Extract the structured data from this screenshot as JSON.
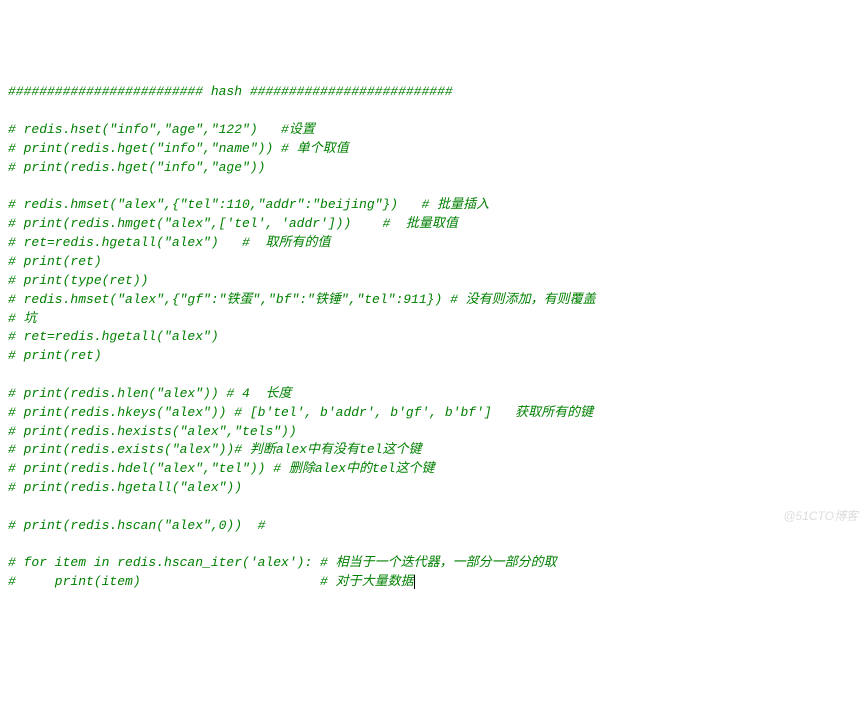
{
  "lines": [
    {
      "t": "comment",
      "text": "######################### hash ##########################"
    },
    {
      "t": "blank",
      "text": ""
    },
    {
      "t": "comment",
      "text": "# redis.hset(\"info\",\"age\",\"122\")   #设置"
    },
    {
      "t": "comment",
      "text": "# print(redis.hget(\"info\",\"name\")) # 单个取值"
    },
    {
      "t": "comment",
      "text": "# print(redis.hget(\"info\",\"age\"))"
    },
    {
      "t": "blank",
      "text": ""
    },
    {
      "t": "comment",
      "text": "# redis.hmset(\"alex\",{\"tel\":110,\"addr\":\"beijing\"})   # 批量插入"
    },
    {
      "t": "comment",
      "text": "# print(redis.hmget(\"alex\",['tel', 'addr']))    #  批量取值"
    },
    {
      "t": "comment",
      "text": "# ret=redis.hgetall(\"alex\")   #  取所有的值"
    },
    {
      "t": "comment",
      "text": "# print(ret)"
    },
    {
      "t": "comment",
      "text": "# print(type(ret))"
    },
    {
      "t": "comment",
      "text": "# redis.hmset(\"alex\",{\"gf\":\"铁蛋\",\"bf\":\"铁锤\",\"tel\":911}) # 没有则添加，有则覆盖"
    },
    {
      "t": "comment",
      "text": "# 坑"
    },
    {
      "t": "comment",
      "text": "# ret=redis.hgetall(\"alex\")"
    },
    {
      "t": "comment",
      "text": "# print(ret)"
    },
    {
      "t": "blank",
      "text": ""
    },
    {
      "t": "comment",
      "text": "# print(redis.hlen(\"alex\")) # 4  长度"
    },
    {
      "t": "comment",
      "text": "# print(redis.hkeys(\"alex\")) # [b'tel', b'addr', b'gf', b'bf']   获取所有的键"
    },
    {
      "t": "comment",
      "text": "# print(redis.hexists(\"alex\",\"tels\"))"
    },
    {
      "t": "comment",
      "text": "# print(redis.exists(\"alex\"))# 判断alex中有没有tel这个键"
    },
    {
      "t": "comment",
      "text": "# print(redis.hdel(\"alex\",\"tel\")) # 删除alex中的tel这个键"
    },
    {
      "t": "comment",
      "text": "# print(redis.hgetall(\"alex\"))"
    },
    {
      "t": "blank",
      "text": ""
    },
    {
      "t": "comment",
      "text": "# print(redis.hscan(\"alex\",0))  #"
    },
    {
      "t": "blank",
      "text": ""
    },
    {
      "t": "comment",
      "text": "# for item in redis.hscan_iter('alex'): # 相当于一个迭代器，一部分一部分的取"
    },
    {
      "t": "comment",
      "text": "#     print(item)                       # 对于大量数据",
      "cursor": true
    }
  ],
  "watermark": "@51CTO博客"
}
